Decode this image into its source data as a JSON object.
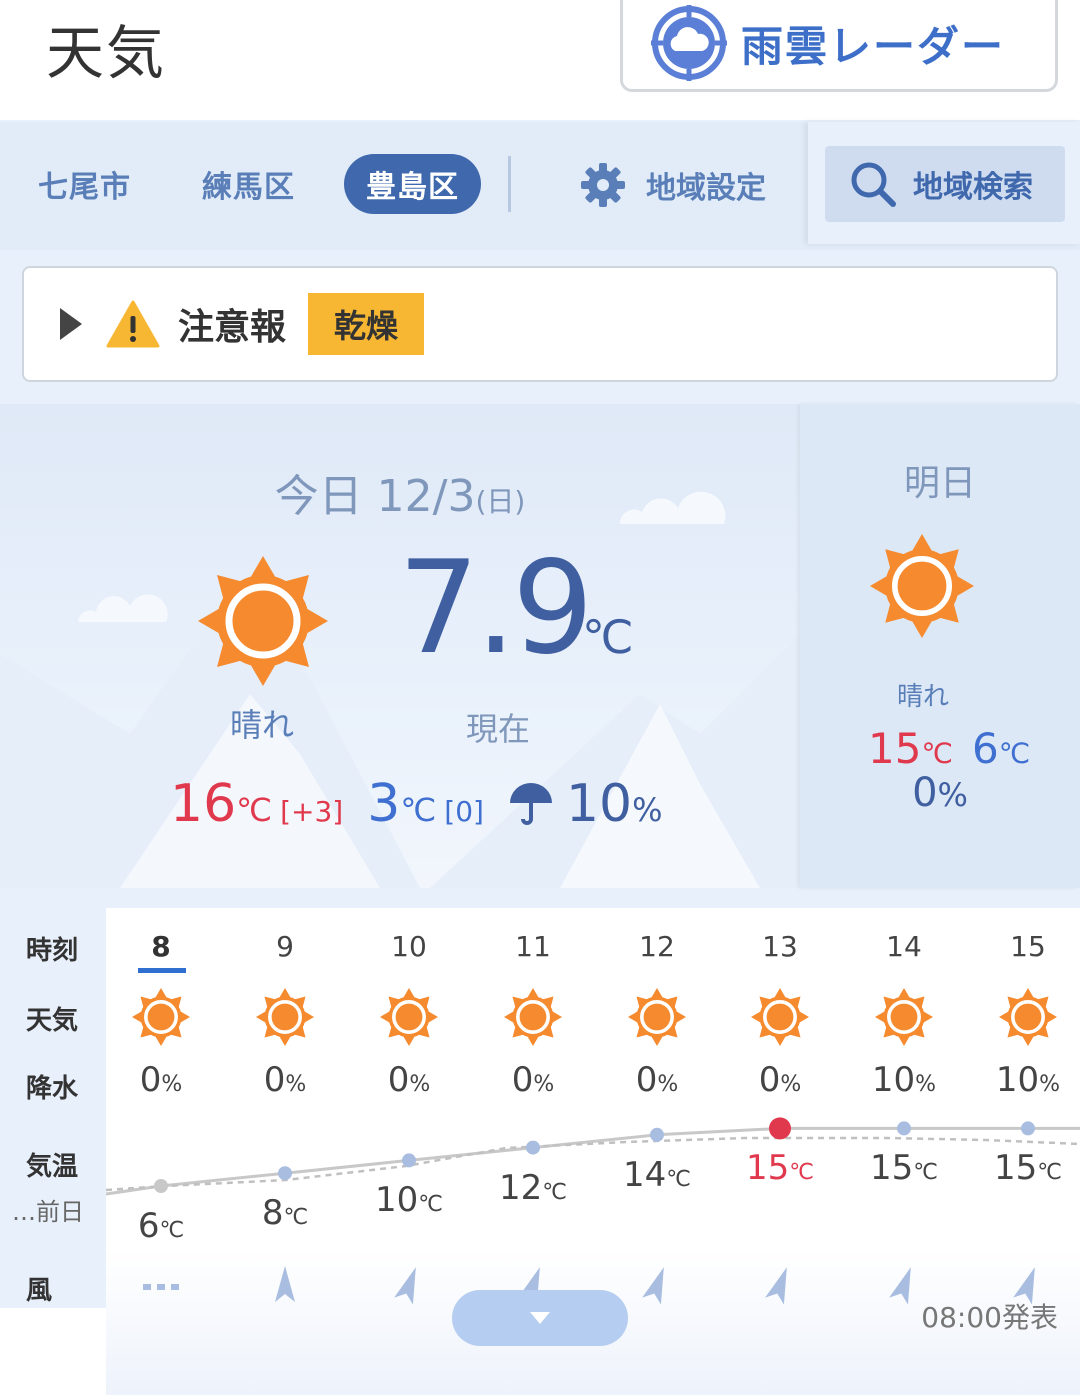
{
  "header": {
    "title": "天気",
    "radar_label": "雨雲レーダー"
  },
  "nav": {
    "regions": [
      "七尾市",
      "練馬区",
      "豊島区"
    ],
    "active_region": "豊島区",
    "settings_label": "地域設定",
    "search_label": "地域検索"
  },
  "alert": {
    "label": "注意報",
    "tag": "乾燥"
  },
  "today": {
    "date_prefix": "今日 12/3",
    "weekday": "(日)",
    "condition": "晴れ",
    "current_temp": "7.9",
    "current_unit": "℃",
    "current_label": "現在",
    "high": "16",
    "high_delta": "[+3]",
    "low": "3",
    "low_delta": "[0]",
    "rain_chance": "10",
    "unit": "℃",
    "percent": "%"
  },
  "tomorrow": {
    "label": "明日",
    "condition": "晴れ",
    "high": "15",
    "low": "6",
    "rain_chance": "0"
  },
  "hourly": {
    "row_labels": {
      "time": "時刻",
      "weather": "天気",
      "precip": "降水",
      "temp": "気温",
      "prev_day": "…前日",
      "wind": "風"
    },
    "hours": [
      "8",
      "9",
      "10",
      "11",
      "12",
      "13",
      "14",
      "15"
    ],
    "precip": [
      "0",
      "0",
      "0",
      "0",
      "0",
      "0",
      "10",
      "10"
    ],
    "temps": [
      "6",
      "8",
      "10",
      "12",
      "14",
      "15",
      "15",
      "15"
    ],
    "published": "08:00発表"
  },
  "colors": {
    "accent_blue": "#3f68ad",
    "sun_orange": "#f58a2e",
    "high_red": "#e0394d",
    "low_blue": "#3f6fd0",
    "alert_yellow": "#f7b733"
  }
}
